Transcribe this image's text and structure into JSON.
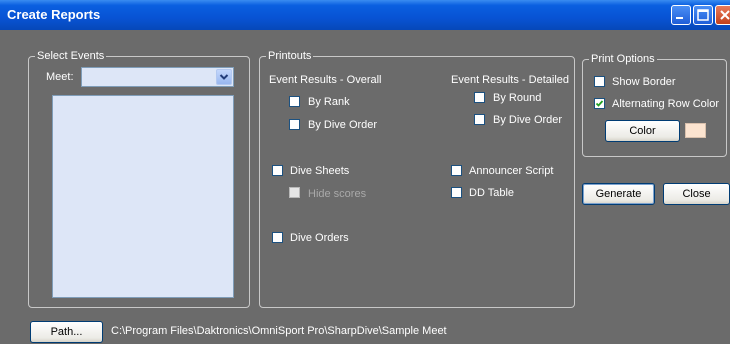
{
  "window": {
    "title": "Create Reports"
  },
  "select_events": {
    "legend": "Select Events",
    "meet_label": "Meet:",
    "meet_value": ""
  },
  "printouts": {
    "legend": "Printouts",
    "overall_heading": "Event Results - Overall",
    "detailed_heading": "Event Results - Detailed",
    "by_rank": {
      "label": "By Rank",
      "checked": false
    },
    "overall_by_dive_order": {
      "label": "By Dive Order",
      "checked": false
    },
    "by_round": {
      "label": "By Round",
      "checked": false
    },
    "detailed_by_dive_order": {
      "label": "By Dive Order",
      "checked": false
    },
    "dive_sheets": {
      "label": "Dive Sheets",
      "checked": false
    },
    "hide_scores": {
      "label": "Hide scores",
      "checked": false,
      "enabled": false
    },
    "announcer_script": {
      "label": "Announcer Script",
      "checked": false
    },
    "dd_table": {
      "label": "DD Table",
      "checked": false
    },
    "dive_orders": {
      "label": "Dive Orders",
      "checked": false
    }
  },
  "print_options": {
    "legend": "Print Options",
    "show_border": {
      "label": "Show Border",
      "checked": false
    },
    "alternating_row_color": {
      "label": "Alternating Row Color",
      "checked": true
    },
    "color_button": "Color",
    "swatch_color": "#fce4d0"
  },
  "actions": {
    "generate": "Generate",
    "close": "Close"
  },
  "footer": {
    "path_button": "Path...",
    "path_value": "C:\\Program Files\\Daktronics\\OmniSport Pro\\SharpDive\\Sample Meet"
  },
  "colors": {
    "window_bg": "#6b6b6b",
    "titlebar": "#0853d4",
    "list_bg": "#dde6f7",
    "button_border": "#003c74"
  },
  "icons": {
    "minimize": "minimize-icon",
    "maximize": "maximize-icon",
    "close": "close-icon",
    "dropdown": "chevron-down-icon",
    "check": "checkmark-icon"
  }
}
